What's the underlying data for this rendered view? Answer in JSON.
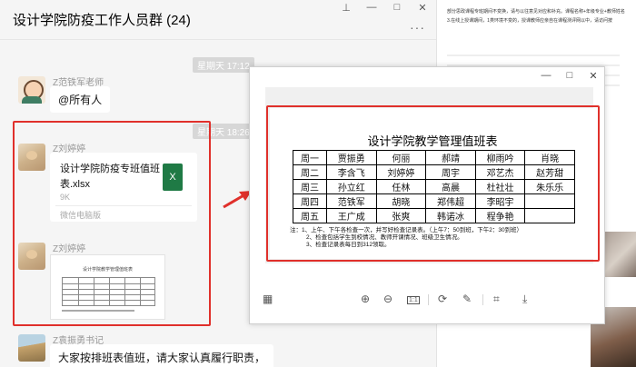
{
  "chat": {
    "title": "设计学院防疫工作人员群 (24)",
    "window_controls": [
      "⊥",
      "—",
      "□",
      "✕"
    ],
    "more_icon": "···",
    "messages": [
      {
        "type": "time",
        "text": "星期天 17:12"
      },
      {
        "type": "text",
        "sender": "Z范铁军老师",
        "text": "@所有人",
        "avatar": "cartoon"
      },
      {
        "type": "time",
        "text": "星期天 18:26"
      },
      {
        "type": "file",
        "sender": "Z刘婷婷",
        "file_name": "设计学院防疫专班值班表.xlsx",
        "file_size": "9K",
        "source": "微信电脑版",
        "icon": "X"
      },
      {
        "type": "image",
        "sender": "Z刘婷婷",
        "thumb_title": "设计学院教学管理值班表"
      },
      {
        "type": "text",
        "sender": "Z袁振勇书记",
        "text": "大家按排班表值班，请大家认真履行职责，"
      }
    ]
  },
  "viewer": {
    "window_controls": [
      "—",
      "□",
      "✕"
    ],
    "doc": {
      "title": "设计学院教学管理值班表",
      "rows": [
        [
          "周一",
          "贾振勇",
          "何丽",
          "郝靖",
          "柳雨吟",
          "肖晓"
        ],
        [
          "周二",
          "李含飞",
          "刘婷婷",
          "周宇",
          "邓艺杰",
          "赵芳甜"
        ],
        [
          "周三",
          "孙立红",
          "任林",
          "高晨",
          "杜社壮",
          "朱乐乐"
        ],
        [
          "周四",
          "范铁军",
          "胡晓",
          "郑伟超",
          "李昭宇",
          ""
        ],
        [
          "周五",
          "王广成",
          "张爽",
          "韩诺冰",
          "程争艳",
          ""
        ]
      ],
      "notes": [
        "注：1、上午、下午各检查一次，并写好检查记录表。（上午7：50到班，下午2：30到班）",
        "2、检查包括学生到校情况、教师开课情况、班级卫生情况。",
        "3、检查记录表每日到312领取。"
      ]
    },
    "toolbar_icons": [
      "grid-icon",
      "zoom-in-icon",
      "zoom-out-icon",
      "actual-size-icon",
      "rotate-icon",
      "edit-icon",
      "crop-icon",
      "download-icon"
    ],
    "actual_size_label": "1:1"
  },
  "background_doc": {
    "lines": [
      "部分思政课程专班期间不变换，请与以往意见对应和补充。课程名称+年级专业+教师姓名",
      "3.在线上授课期间，1类环境不变的，授课教师应亲自在课程测评网以中，请访问按"
    ]
  },
  "colors": {
    "highlight": "#e0302b",
    "excel": "#1f7a45"
  }
}
